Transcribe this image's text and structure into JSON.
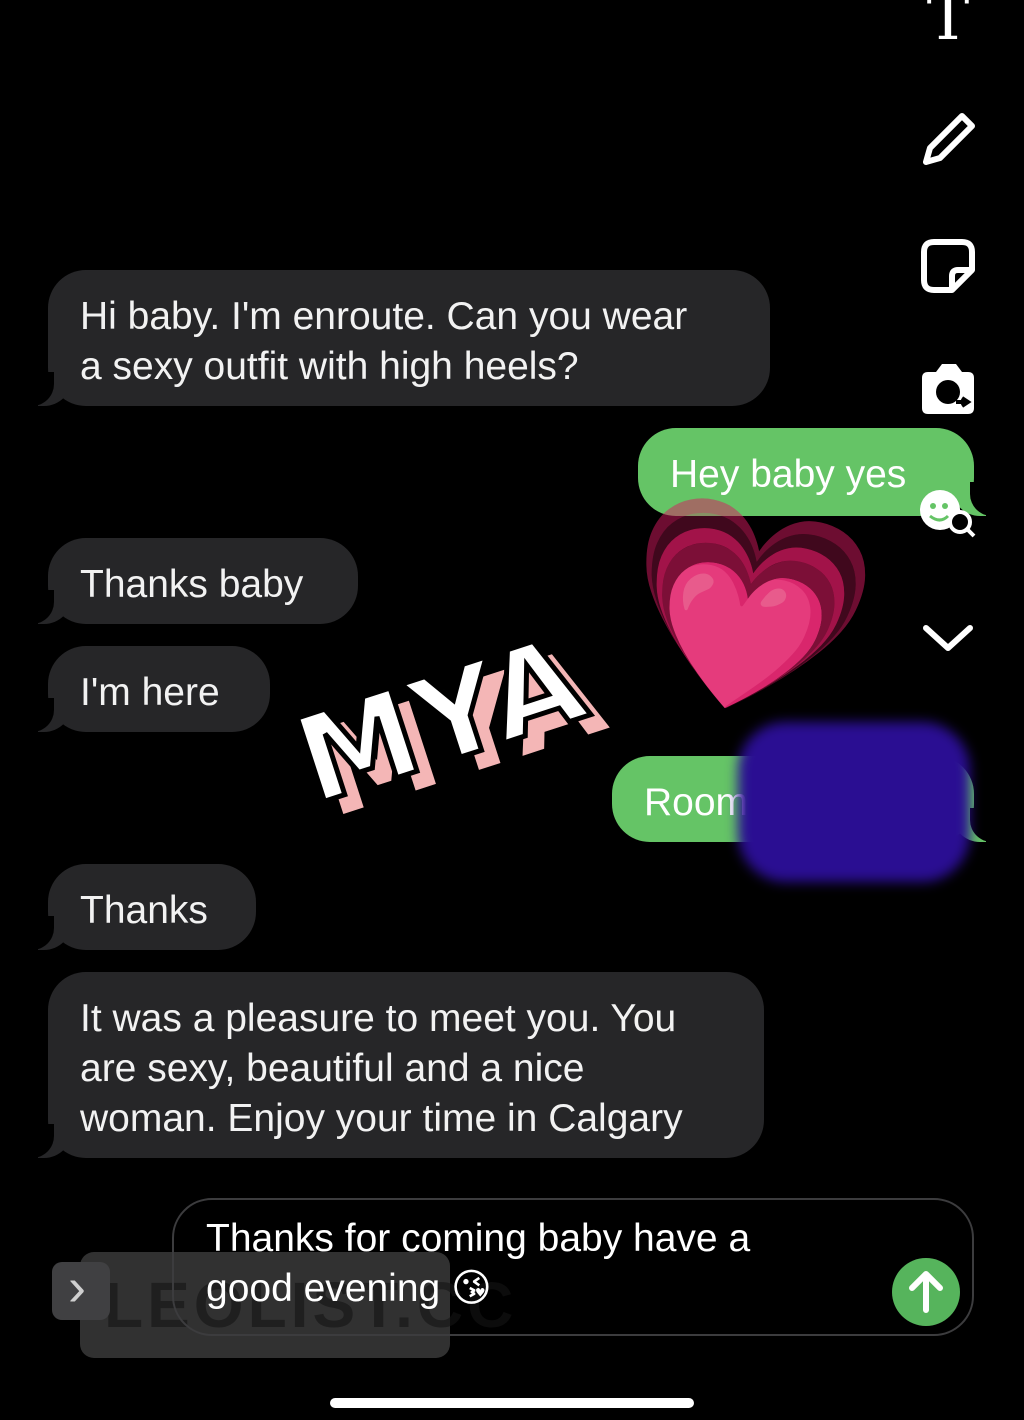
{
  "messages": {
    "m1": "Hi baby. I'm enroute. Can you wear\na sexy outfit with high heels?",
    "m2": "Hey baby yes",
    "m3": "Thanks baby",
    "m4": "I'm here",
    "m5": "Room",
    "m6": "Thanks",
    "m7": "It was a pleasure to meet you. You\nare sexy, beautiful and a nice\nwoman. Enjoy your time in Calgary"
  },
  "overlay": {
    "name": "MYA",
    "heart": "💗"
  },
  "composer": {
    "text": "Thanks for coming baby have a\ngood evening ",
    "emoji": "😘",
    "send_glyph": "↑",
    "expand_glyph": "›"
  },
  "watermark": "LEOLIST.CC",
  "toolbar": {
    "text_tool": "T"
  },
  "icons": [
    "text-tool-icon",
    "pencil-icon",
    "sticker-icon",
    "camera-swap-icon",
    "emoji-search-icon",
    "chevron-down-icon"
  ],
  "colors": {
    "incoming_bubble": "#262628",
    "outgoing_bubble": "#65c466",
    "redaction": "#2a0e92",
    "heart": "#e83dae"
  }
}
